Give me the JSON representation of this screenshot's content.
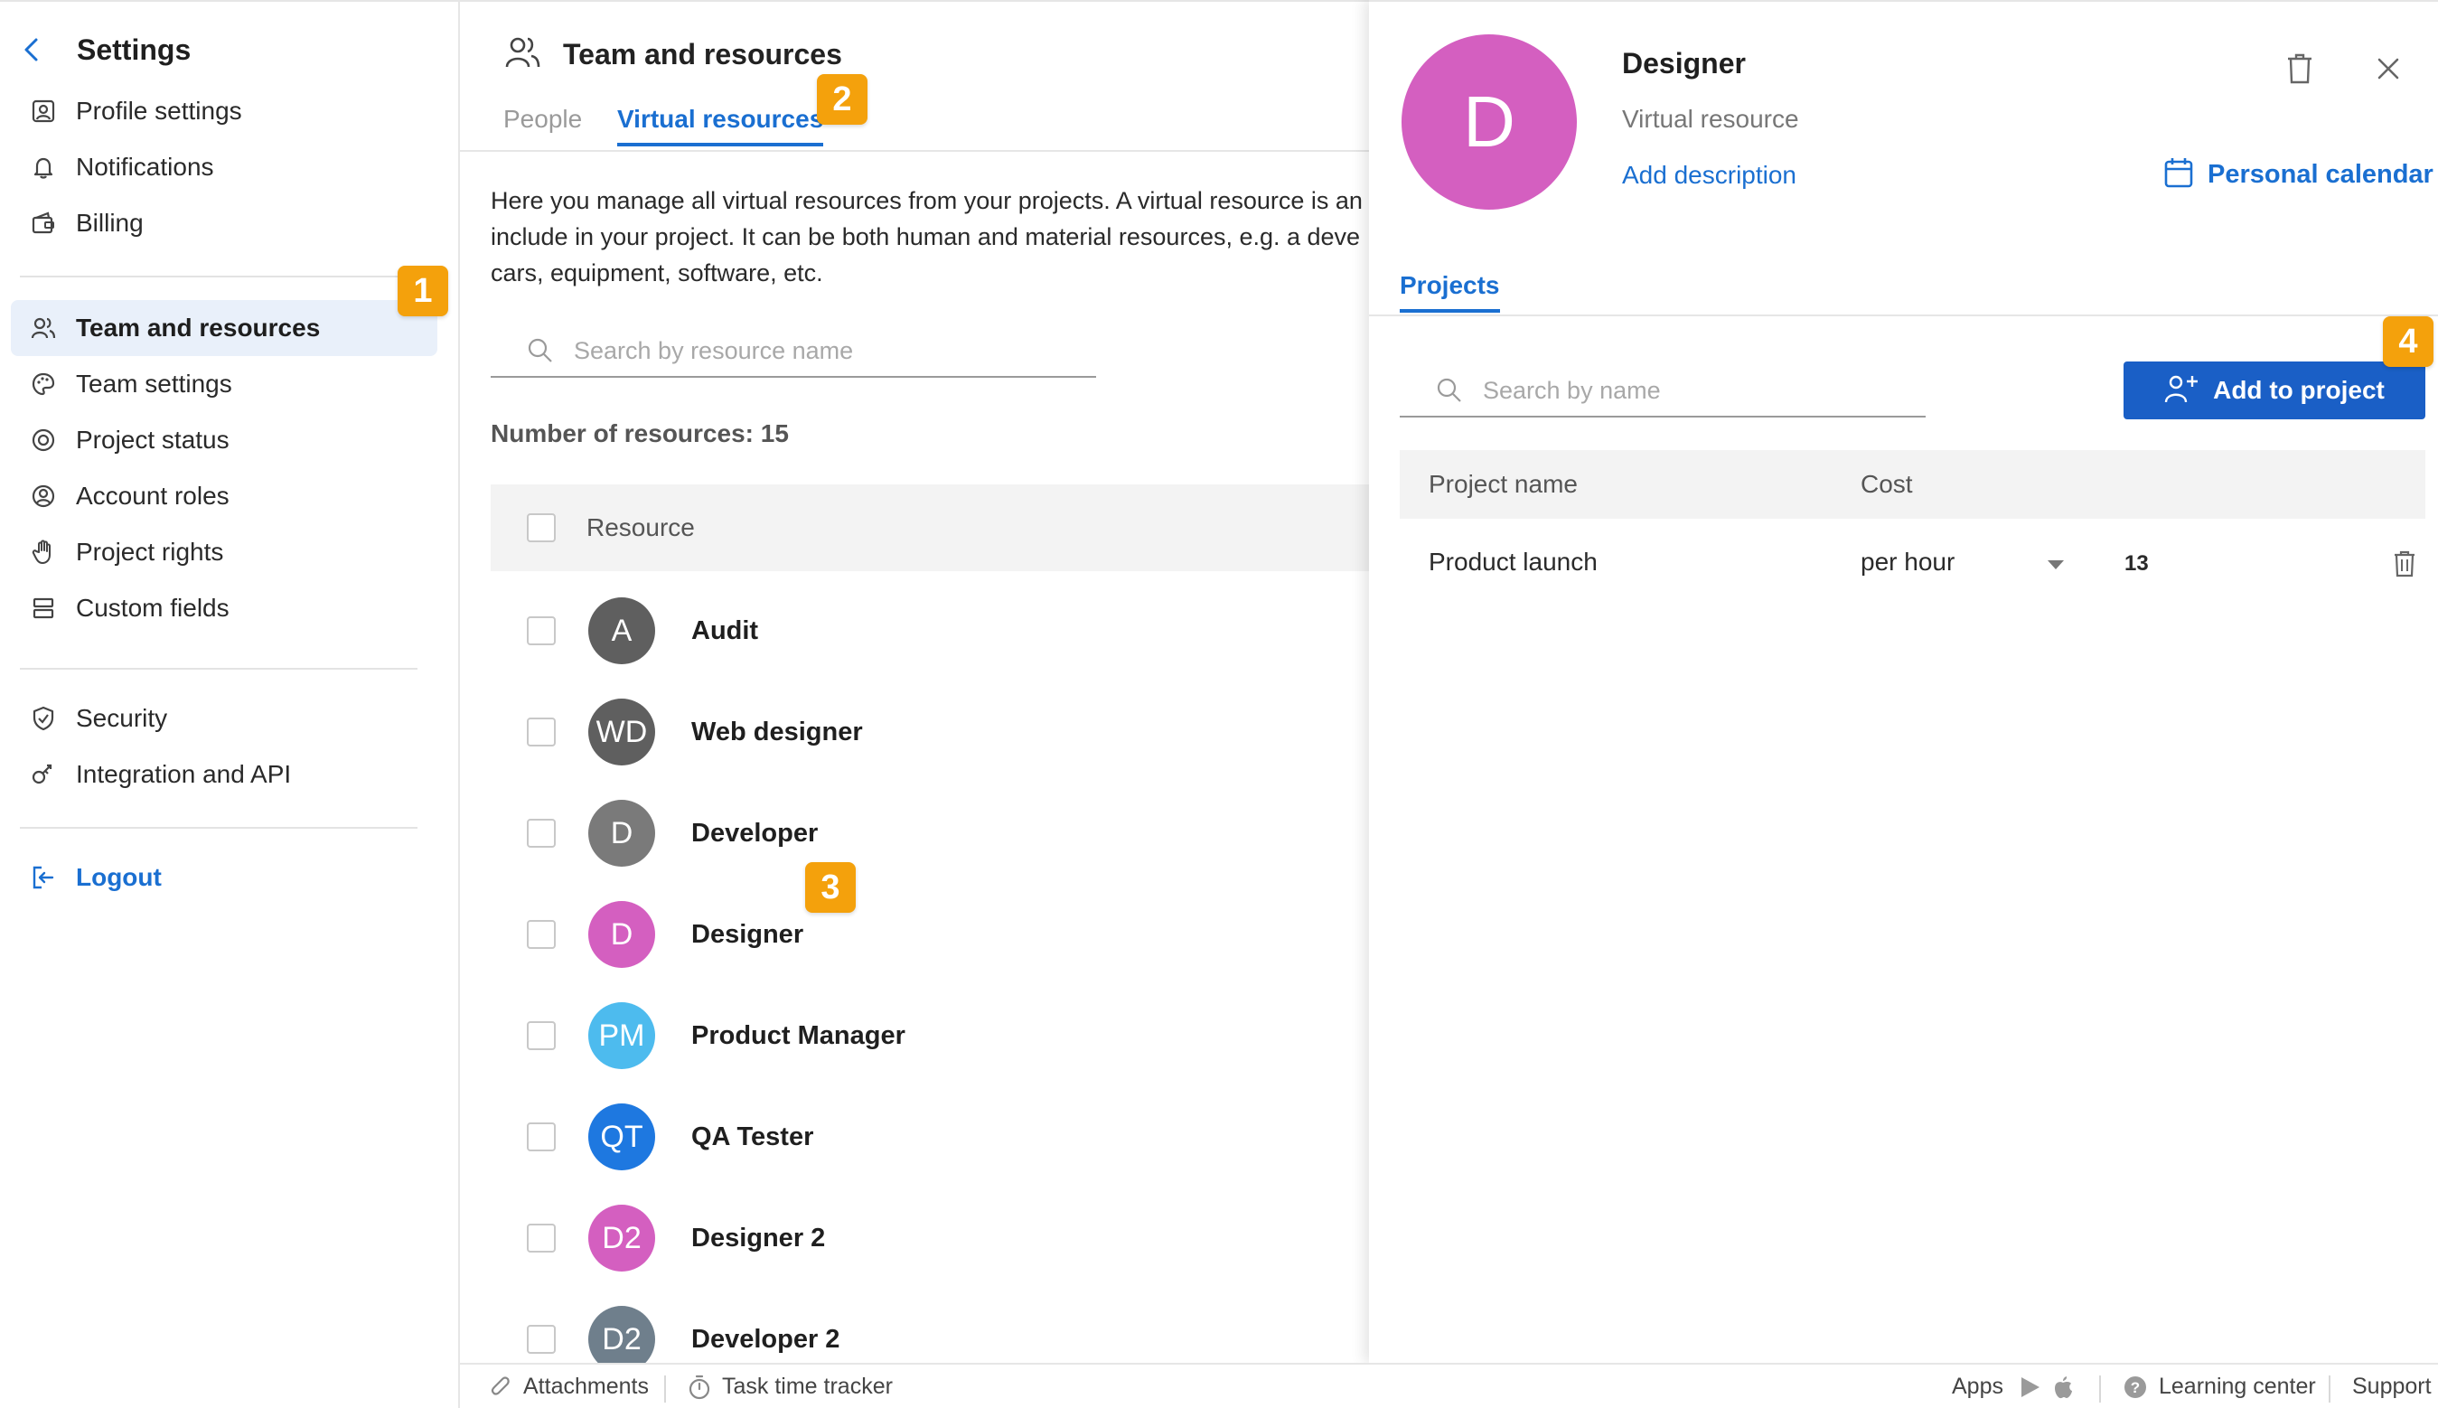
{
  "sidebar": {
    "title": "Settings",
    "items_top": [
      {
        "label": "Profile settings",
        "icon": "user-card-icon"
      },
      {
        "label": "Notifications",
        "icon": "bell-icon"
      },
      {
        "label": "Billing",
        "icon": "wallet-icon"
      }
    ],
    "items_mid": [
      {
        "label": "Team and resources",
        "icon": "team-icon",
        "active": true
      },
      {
        "label": "Team settings",
        "icon": "palette-icon"
      },
      {
        "label": "Project status",
        "icon": "status-icon"
      },
      {
        "label": "Account roles",
        "icon": "user-circle-icon"
      },
      {
        "label": "Project rights",
        "icon": "hand-icon"
      },
      {
        "label": "Custom fields",
        "icon": "fields-icon"
      }
    ],
    "items_bottom": [
      {
        "label": "Security",
        "icon": "shield-icon"
      },
      {
        "label": "Integration and API",
        "icon": "integration-icon"
      }
    ],
    "logout": "Logout"
  },
  "badges": [
    "1",
    "2",
    "3",
    "4"
  ],
  "main": {
    "title": "Team and resources",
    "tabs": [
      "People",
      "Virtual resources"
    ],
    "intro_lines": [
      "Here you manage all virtual resources from your projects. A virtual resource is an",
      "include in your project. It can be both human and material resources, e.g. a deve",
      "cars, equipment, software, etc."
    ],
    "search_placeholder": "Search by resource name",
    "count_label": "Number of resources: 15",
    "column_resource": "Resource",
    "resources": [
      {
        "initials": "A",
        "name": "Audit",
        "color": "#5f5f5f"
      },
      {
        "initials": "WD",
        "name": "Web designer",
        "color": "#5f5f5f"
      },
      {
        "initials": "D",
        "name": "Developer",
        "color": "#7a7a7a"
      },
      {
        "initials": "D",
        "name": "Designer",
        "color": "#d45fc0"
      },
      {
        "initials": "PM",
        "name": "Product Manager",
        "color": "#4dbbee"
      },
      {
        "initials": "QT",
        "name": "QA Tester",
        "color": "#1e78e0"
      },
      {
        "initials": "D2",
        "name": "Designer 2",
        "color": "#d45fc0"
      },
      {
        "initials": "D2",
        "name": "Developer 2",
        "color": "#6f7f8c"
      }
    ]
  },
  "panel": {
    "avatar_initial": "D",
    "avatar_color": "#d45fc0",
    "name": "Designer",
    "subtitle": "Virtual resource",
    "add_description": "Add description",
    "personal_calendar": "Personal calendar",
    "tab": "Projects",
    "search_placeholder": "Search by name",
    "add_button": "Add to project",
    "col_project": "Project name",
    "col_cost": "Cost",
    "rows": [
      {
        "project": "Product launch",
        "unit": "per hour",
        "value": "13"
      }
    ]
  },
  "footer": {
    "attachments": "Attachments",
    "tracker": "Task time tracker",
    "apps": "Apps",
    "learning": "Learning center",
    "support": "Support"
  },
  "colors": {
    "accent": "#1a6fd1",
    "badge": "#f4a10c",
    "button": "#1a5fc6"
  }
}
